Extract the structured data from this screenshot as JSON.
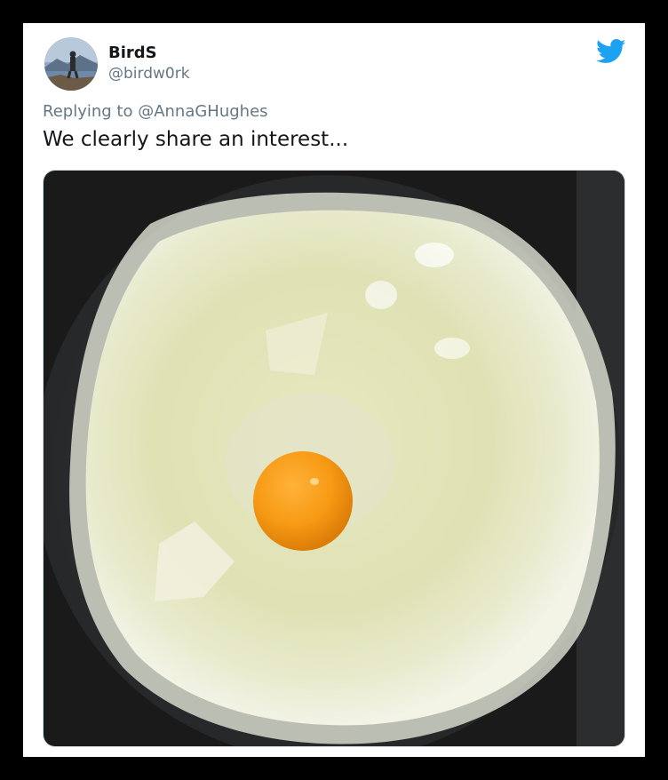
{
  "tweet": {
    "display_name": "BirdS",
    "handle": "@birdw0rk",
    "reply_prefix": "Replying to ",
    "reply_to": "@AnnaGHughes",
    "text": "We clearly share an interest..."
  },
  "icons": {
    "logo": "twitter-bird-icon",
    "avatar": "profile-photo"
  },
  "colors": {
    "twitter_blue": "#1DA1F2",
    "text_primary": "#14171a",
    "text_secondary": "#657786",
    "frame": "#000000",
    "card": "#ffffff"
  }
}
